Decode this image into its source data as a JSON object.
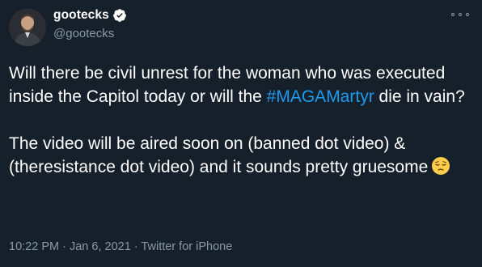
{
  "tweet": {
    "display_name": "gootecks",
    "handle": "@gootecks",
    "body": {
      "p1_a": "Will there be civil unrest for the woman who was executed inside the Capitol today or will the ",
      "hashtag": "#MAGAMartyr",
      "p1_b": " die in vain?",
      "p2": "The video will be aired soon on (banned dot video) & (theresistance dot video)  and it sounds pretty gruesome"
    },
    "time": "10:22 PM",
    "separator": "·",
    "date": "Jan 6, 2021",
    "source": "Twitter for iPhone"
  },
  "colors": {
    "background": "#15202b",
    "text": "#ffffff",
    "secondary": "#8b98a5",
    "link": "#1d9bf0"
  },
  "icons": [
    "verified-badge-icon",
    "more-options-icon",
    "pensive-face-emoji"
  ]
}
